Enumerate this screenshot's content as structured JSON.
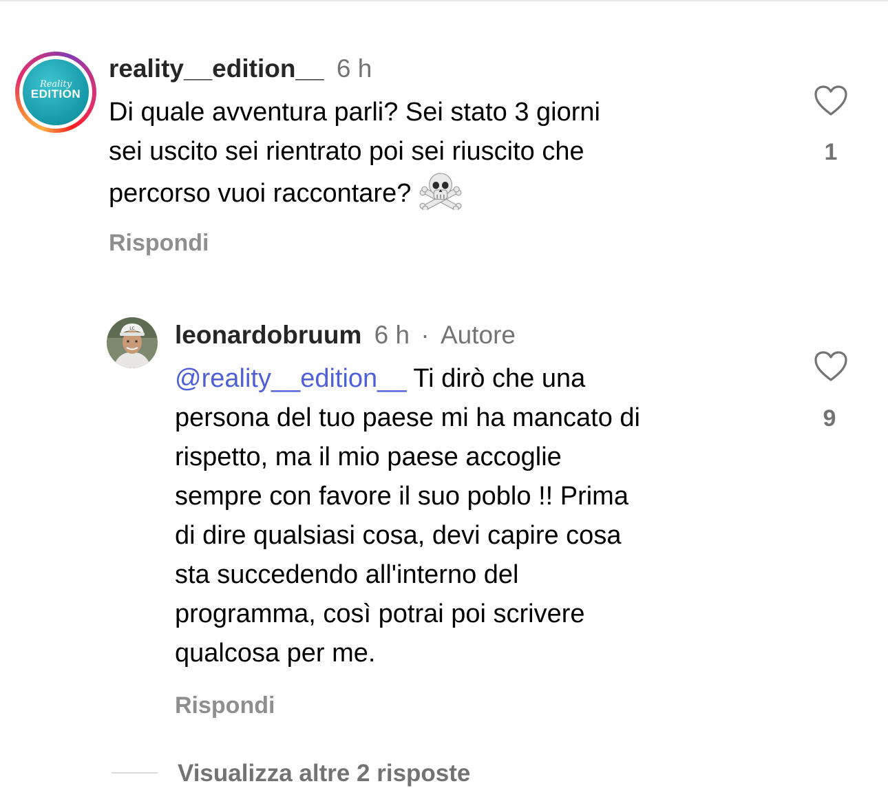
{
  "comments": [
    {
      "username": "reality__edition__",
      "time": "6 h",
      "avatar_text_top": "Reality",
      "avatar_text_main": "EDITION",
      "lines": [
        "Di quale avventura parli? Sei stato 3 giorni",
        "sei uscito sei rientrato poi sei riuscito che",
        "percorso vuoi raccontare?"
      ],
      "emoji": "skull-and-crossbones",
      "reply_label": "Rispondi",
      "likes": "1"
    },
    {
      "username": "leonardobruum",
      "time": "6 h",
      "separator": "·",
      "badge": "Autore",
      "mention": "@reality__edition__",
      "first_line_rest": " Ti dirò che una",
      "lines": [
        "persona del tuo paese mi ha mancato di",
        "rispetto, ma il mio paese accoglie",
        "sempre con favore il suo poblo !! Prima",
        "di dire qualsiasi cosa, devi capire cosa",
        "sta succedendo all'interno del",
        "programma, così potrai poi scrivere",
        "qualcosa per me."
      ],
      "reply_label": "Rispondi",
      "likes": "9"
    }
  ],
  "view_more_label": "Visualizza altre 2 risposte",
  "colors": {
    "mention": "#4f5fd6",
    "meta": "#737373",
    "reply": "#8e8e8e",
    "ring_gradient": [
      "#fcaf45",
      "#e1306c",
      "#833ab4"
    ]
  }
}
